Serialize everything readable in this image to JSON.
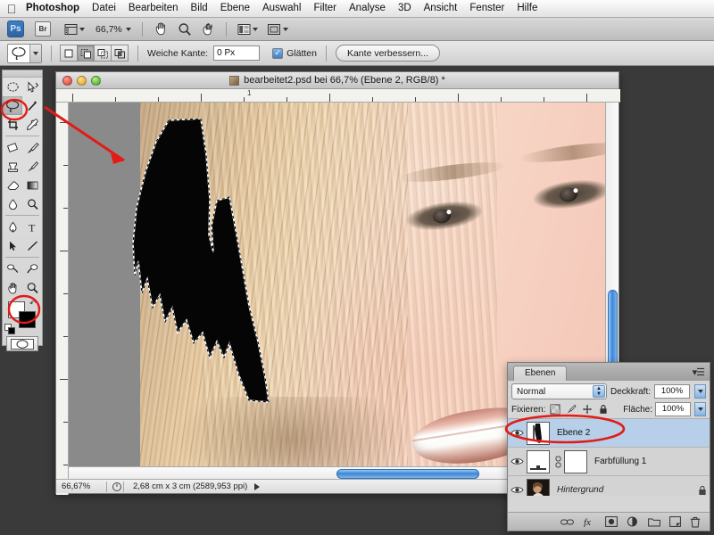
{
  "menubar": {
    "apple": "apple-logo",
    "items": [
      {
        "label": "Photoshop",
        "bold": true
      },
      {
        "label": "Datei"
      },
      {
        "label": "Bearbeiten"
      },
      {
        "label": "Bild"
      },
      {
        "label": "Ebene"
      },
      {
        "label": "Auswahl"
      },
      {
        "label": "Filter"
      },
      {
        "label": "Analyse"
      },
      {
        "label": "3D"
      },
      {
        "label": "Ansicht"
      },
      {
        "label": "Fenster"
      },
      {
        "label": "Hilfe"
      }
    ]
  },
  "appbar": {
    "ps_label": "Ps",
    "bridge_label": "Br",
    "zoom_level": "66,7%",
    "icons": [
      "view-extras-icon",
      "hand-icon",
      "zoom-icon",
      "rotate-view-icon",
      "arrange-documents-icon",
      "screen-mode-icon"
    ]
  },
  "optionsbar": {
    "tool": "lasso-tool",
    "selection_modes": [
      "new-selection",
      "add-to-selection",
      "subtract-from-selection",
      "intersect-selection"
    ],
    "active_selection_mode": 1,
    "feather_label": "Weiche Kante:",
    "feather_value": "0 Px",
    "antialias_label": "Glätten",
    "antialias_checked": true,
    "refine_edge_label": "Kante verbessern..."
  },
  "toolpalette": {
    "tools": [
      "marquee-tool",
      "move-tool",
      "lasso-tool",
      "magic-wand-tool",
      "crop-tool",
      "eyedropper-tool",
      "healing-brush-tool",
      "brush-tool",
      "clone-stamp-tool",
      "history-brush-tool",
      "eraser-tool",
      "gradient-tool",
      "blur-tool",
      "dodge-tool",
      "pen-tool",
      "type-tool",
      "path-selection-tool",
      "line-tool",
      "dodge-burn-tool",
      "sponge-tool",
      "hand-tool",
      "zoom-tool"
    ],
    "active_tool": "lasso-tool",
    "foreground_color": "#ffffff",
    "background_color": "#000000",
    "quickmask_label": "quick-mask-icon"
  },
  "document": {
    "title": "bearbeitet2.psd bei 66,7% (Ebene 2, RGB/8) *",
    "ruler_label": "1",
    "statusbar": {
      "zoom": "66,67%",
      "dimensions": "2,68 cm x 3 cm (2589,953 ppi)"
    }
  },
  "layerspanel": {
    "tab_label": "Ebenen",
    "blend_mode": "Normal",
    "opacity_label": "Deckkraft:",
    "opacity_value": "100%",
    "lock_label": "Fixieren:",
    "fill_label": "Fläche:",
    "fill_value": "100%",
    "lock_icons": [
      "lock-transparency-icon",
      "lock-image-icon",
      "lock-position-icon",
      "lock-all-icon"
    ],
    "layers": [
      {
        "name": "Ebene 2",
        "selected": true,
        "visible": true,
        "italic": false,
        "locked": false,
        "thumb": "mask-thumbnail"
      },
      {
        "name": "Farbfüllung 1",
        "selected": false,
        "visible": true,
        "italic": false,
        "locked": false,
        "thumb": "fill-layer-thumbnail"
      },
      {
        "name": "Hintergrund",
        "selected": false,
        "visible": true,
        "italic": true,
        "locked": true,
        "thumb": "portrait-thumbnail"
      }
    ],
    "footer_icons": [
      "link-layers-icon",
      "layer-style-icon",
      "layer-mask-icon",
      "adjustment-layer-icon",
      "new-group-icon",
      "new-layer-icon",
      "delete-layer-icon"
    ]
  },
  "annotations": {
    "arrow_color": "#e31b16",
    "ellipse_color": "#e31b16",
    "arrow_name": "red-arrow-annotation",
    "ellipse_tool_name": "red-ellipse-lasso-annotation",
    "ellipse_swatch_name": "red-ellipse-colorswatch-annotation",
    "ellipse_layer_name": "red-ellipse-layer-annotation"
  }
}
